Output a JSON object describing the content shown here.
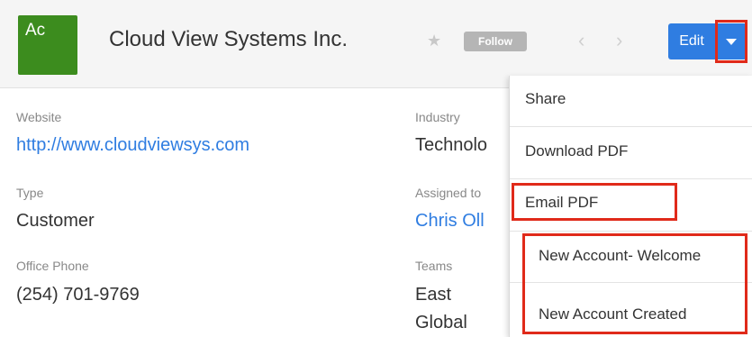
{
  "header": {
    "avatar_text": "Ac",
    "avatar_color": "#3c8c1e",
    "record_name": "Cloud View Systems Inc.",
    "star_icon": "star-icon",
    "follow_label": "Follow",
    "prev_icon": "chevron-left-icon",
    "next_icon": "chevron-right-icon",
    "edit_label": "Edit",
    "accent_color": "#2f7de1",
    "highlight_color": "#e02a1a"
  },
  "fields": {
    "website_label": "Website",
    "website_value": "http://www.cloudviewsys.com",
    "type_label": "Type",
    "type_value": "Customer",
    "office_phone_label": "Office Phone",
    "office_phone_value": "(254) 701-9769",
    "industry_label": "Industry",
    "industry_value": "Technolo",
    "assigned_label": "Assigned to",
    "assigned_value": "Chris Oll",
    "teams_label": "Teams",
    "teams_values": [
      "East",
      "Global"
    ]
  },
  "menu": {
    "items": [
      {
        "label": "Share"
      },
      {
        "label": "Download PDF"
      },
      {
        "label": "Email PDF"
      },
      {
        "label": "New Account- Welcome"
      },
      {
        "label": "New Account Created"
      }
    ]
  }
}
